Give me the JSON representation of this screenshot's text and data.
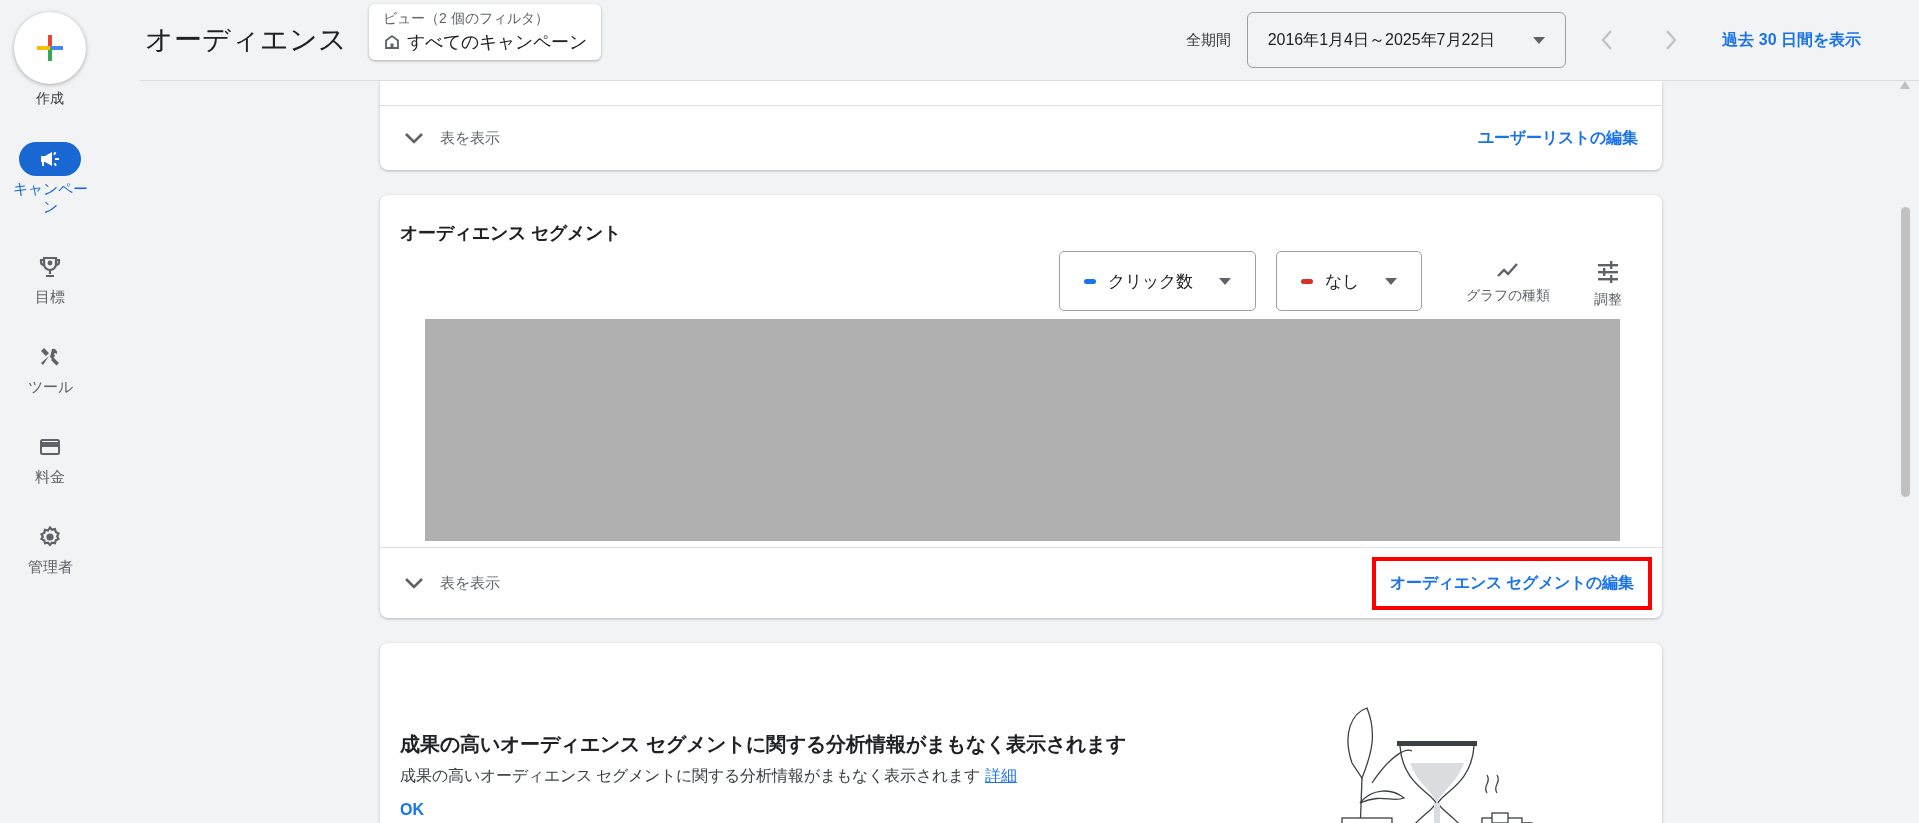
{
  "sidebar": {
    "create_label": "作成",
    "items": [
      {
        "kind": "megaphone",
        "label": "キャンペーン",
        "selected": true
      },
      {
        "kind": "trophy",
        "label": "目標",
        "selected": false
      },
      {
        "kind": "tools",
        "label": "ツール",
        "selected": false
      },
      {
        "kind": "card",
        "label": "料金",
        "selected": false
      },
      {
        "kind": "gear",
        "label": "管理者",
        "selected": false
      }
    ]
  },
  "header": {
    "title": "オーディエンス",
    "view": {
      "label": "ビュー（2 個のフィルタ）",
      "value": "すべてのキャンペーン"
    },
    "period_label": "全期間",
    "date_range": "2016年1月4日～2025年7月22日",
    "show_last_30": "過去 30 日間を表示"
  },
  "user_list_card": {
    "toggle": "表を表示",
    "edit_link": "ユーザーリストの編集"
  },
  "segments_card": {
    "title": "オーディエンス セグメント",
    "metrics": [
      {
        "label": "クリック数",
        "color": "#1a73e8"
      },
      {
        "label": "なし",
        "color": "#d93025"
      }
    ],
    "tools": [
      {
        "kind": "chart_type",
        "label": "グラフの種類"
      },
      {
        "kind": "adjust",
        "label": "調整"
      }
    ],
    "toggle": "表を表示",
    "edit_link": {
      "label": "オーディエンス セグメントの編集",
      "highlighted": true
    }
  },
  "insight_card": {
    "title": "成果の高いオーディエンス セグメントに関する分析情報がまもなく表示されます",
    "text": "成果の高いオーディエンス セグメントに関する分析情報がまもなく表示されます",
    "link": "詳細",
    "ok": "OK"
  }
}
